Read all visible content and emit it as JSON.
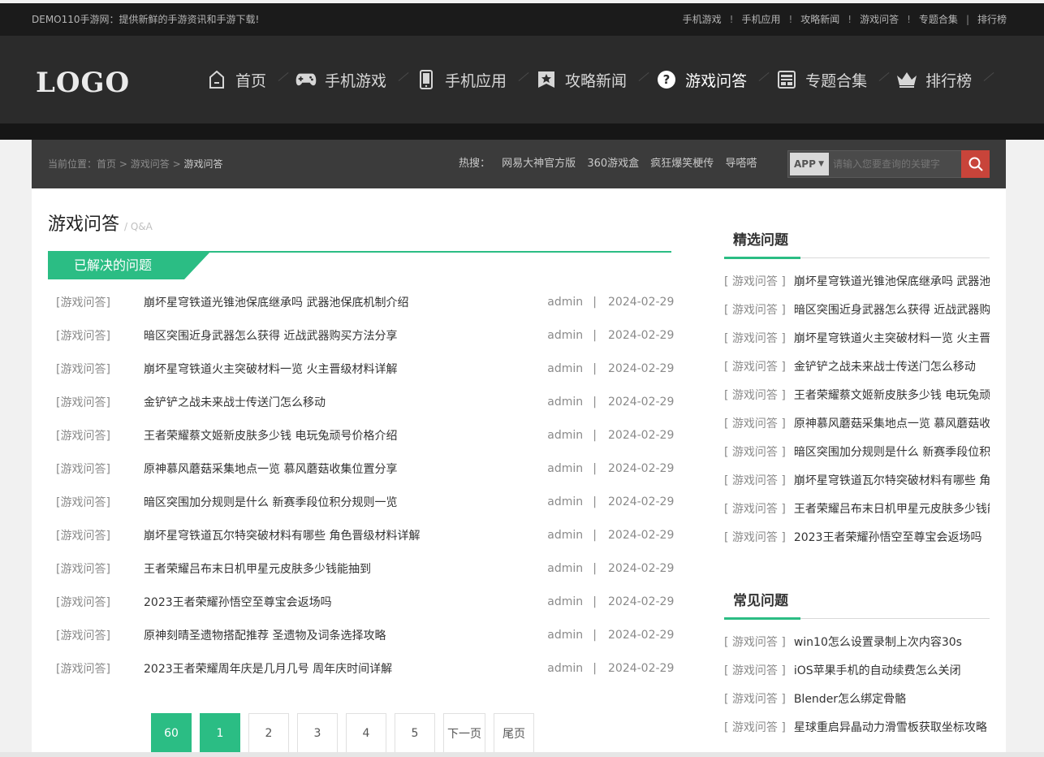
{
  "topbar": {
    "slogan": "DEMO110手游网：提供新鲜的手游资讯和手游下载!",
    "links": [
      "手机游戏",
      "手机应用",
      "攻略新闻",
      "游戏问答",
      "专题合集",
      "排行榜"
    ],
    "separators": [
      "!",
      "!",
      "!",
      "!",
      "|"
    ]
  },
  "header": {
    "logo": "LOGO",
    "nav": [
      {
        "label": "首页",
        "icon": "home-icon"
      },
      {
        "label": "手机游戏",
        "icon": "gamepad-icon"
      },
      {
        "label": "手机应用",
        "icon": "phone-icon"
      },
      {
        "label": "攻略新闻",
        "icon": "bookmark-star-icon"
      },
      {
        "label": "游戏问答",
        "icon": "question-icon",
        "active": true
      },
      {
        "label": "专题合集",
        "icon": "collection-icon"
      },
      {
        "label": "排行榜",
        "icon": "crown-icon"
      }
    ]
  },
  "crumbbar": {
    "prefix": "当前位置：",
    "home": "首页",
    "arrow1": ">",
    "parent": "游戏问答",
    "arrow2": ">",
    "current": "游戏问答",
    "hot_label": "热搜：",
    "hot": [
      "网易大神官方版",
      "360游戏盒",
      "疯狂爆笑梗传",
      "导嗒嗒"
    ],
    "search_type": "APP",
    "search_type_arrow": "▼",
    "search_placeholder": "请输入您要查询的关键字"
  },
  "main": {
    "title": "游戏问答",
    "subtitle": "/ Q&A",
    "section": "已解决的问题",
    "separator": "|",
    "items": [
      {
        "cat": "[游戏问答]",
        "title": "崩坏星穹铁道光锥池保底继承吗 武器池保底机制介绍",
        "author": "admin",
        "date": "2024-02-29"
      },
      {
        "cat": "[游戏问答]",
        "title": "暗区突围近身武器怎么获得 近战武器购买方法分享",
        "author": "admin",
        "date": "2024-02-29"
      },
      {
        "cat": "[游戏问答]",
        "title": "崩坏星穹铁道火主突破材料一览 火主晋级材料详解",
        "author": "admin",
        "date": "2024-02-29"
      },
      {
        "cat": "[游戏问答]",
        "title": "金铲铲之战未来战士传送门怎么移动",
        "author": "admin",
        "date": "2024-02-29"
      },
      {
        "cat": "[游戏问答]",
        "title": "王者荣耀蔡文姬新皮肤多少钱 电玩兔顽号价格介绍",
        "author": "admin",
        "date": "2024-02-29"
      },
      {
        "cat": "[游戏问答]",
        "title": "原神慕风蘑菇采集地点一览 慕风蘑菇收集位置分享",
        "author": "admin",
        "date": "2024-02-29"
      },
      {
        "cat": "[游戏问答]",
        "title": "暗区突围加分规则是什么 新赛季段位积分规则一览",
        "author": "admin",
        "date": "2024-02-29"
      },
      {
        "cat": "[游戏问答]",
        "title": "崩坏星穹铁道瓦尔特突破材料有哪些 角色晋级材料详解",
        "author": "admin",
        "date": "2024-02-29"
      },
      {
        "cat": "[游戏问答]",
        "title": "王者荣耀吕布末日机甲星元皮肤多少钱能抽到",
        "author": "admin",
        "date": "2024-02-29"
      },
      {
        "cat": "[游戏问答]",
        "title": "2023王者荣耀孙悟空至尊宝会返场吗",
        "author": "admin",
        "date": "2024-02-29"
      },
      {
        "cat": "[游戏问答]",
        "title": "原神刻晴圣遗物搭配推荐 圣遗物及词条选择攻略",
        "author": "admin",
        "date": "2024-02-29"
      },
      {
        "cat": "[游戏问答]",
        "title": "2023王者荣耀周年庆是几月几号 周年庆时间详解",
        "author": "admin",
        "date": "2024-02-29"
      }
    ],
    "pager": [
      {
        "label": "60",
        "on": true
      },
      {
        "label": "1",
        "on": true
      },
      {
        "label": "2"
      },
      {
        "label": "3"
      },
      {
        "label": "4"
      },
      {
        "label": "5"
      },
      {
        "label": "下一页"
      },
      {
        "label": "尾页"
      }
    ]
  },
  "sidebar": {
    "featured_title": "精选问题",
    "featured": [
      {
        "cat": "[ 游戏问答 ]",
        "text": "崩坏星穹铁道光锥池保底继承吗 武器池保底机制介绍"
      },
      {
        "cat": "[ 游戏问答 ]",
        "text": "暗区突围近身武器怎么获得 近战武器购买方法分享"
      },
      {
        "cat": "[ 游戏问答 ]",
        "text": "崩坏星穹铁道火主突破材料一览 火主晋级材料详解"
      },
      {
        "cat": "[ 游戏问答 ]",
        "text": "金铲铲之战未来战士传送门怎么移动"
      },
      {
        "cat": "[ 游戏问答 ]",
        "text": "王者荣耀蔡文姬新皮肤多少钱 电玩兔顽号价格介绍"
      },
      {
        "cat": "[ 游戏问答 ]",
        "text": "原神慕风蘑菇采集地点一览 慕风蘑菇收集位置分享"
      },
      {
        "cat": "[ 游戏问答 ]",
        "text": "暗区突围加分规则是什么 新赛季段位积分规则一览"
      },
      {
        "cat": "[ 游戏问答 ]",
        "text": "崩坏星穹铁道瓦尔特突破材料有哪些 角色晋级材料详解"
      },
      {
        "cat": "[ 游戏问答 ]",
        "text": "王者荣耀吕布末日机甲星元皮肤多少钱能抽到"
      },
      {
        "cat": "[ 游戏问答 ]",
        "text": "2023王者荣耀孙悟空至尊宝会返场吗"
      }
    ],
    "common_title": "常见问题",
    "common": [
      {
        "cat": "[ 游戏问答 ]",
        "text": "win10怎么设置录制上次内容30s"
      },
      {
        "cat": "[ 游戏问答 ]",
        "text": "iOS苹果手机的自动续费怎么关闭"
      },
      {
        "cat": "[ 游戏问答 ]",
        "text": "Blender怎么绑定骨骼"
      },
      {
        "cat": "[ 游戏问答 ]",
        "text": "星球重启异晶动力滑雪板获取坐标攻略"
      }
    ]
  },
  "colors": {
    "accent": "#2bbd84",
    "search_button": "#c8443a",
    "header_bg": "#2b2b2b"
  }
}
